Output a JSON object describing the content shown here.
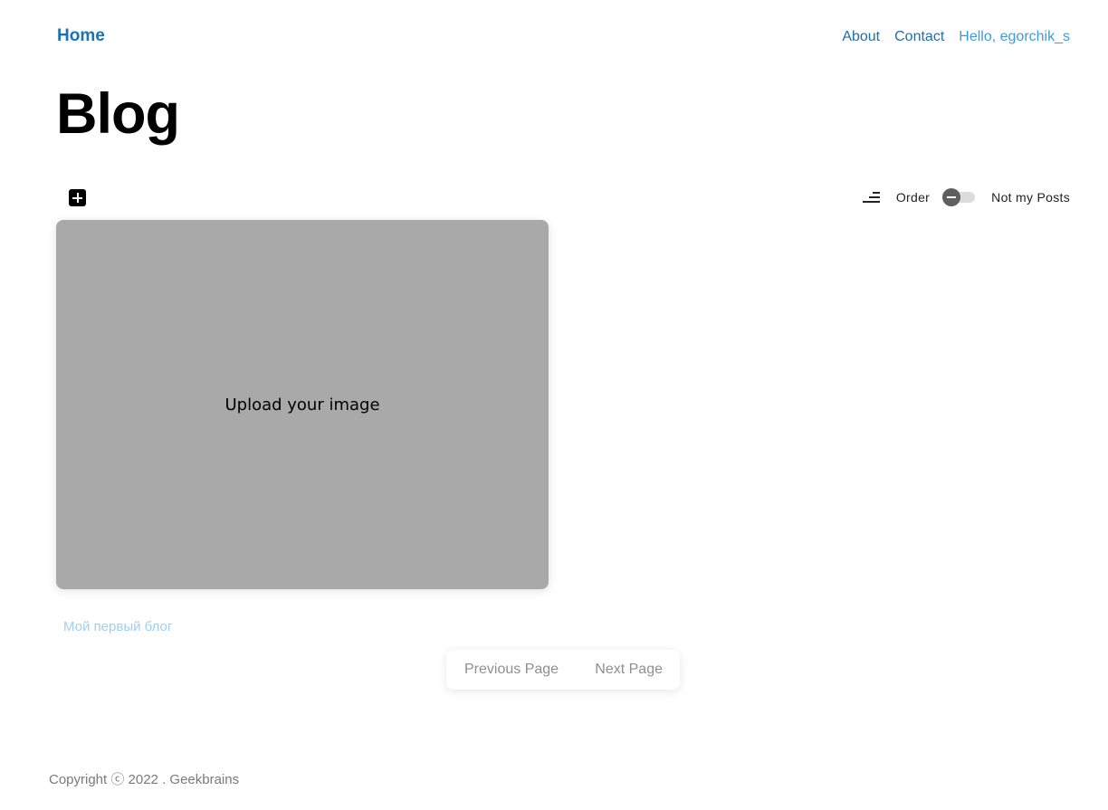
{
  "header": {
    "home_label": "Home",
    "links": [
      {
        "label": "About"
      },
      {
        "label": "Contact"
      }
    ],
    "user_greeting": "Hello, egorchik_s"
  },
  "page": {
    "title": "Blog"
  },
  "toolbar": {
    "add_icon": "plus-square-icon",
    "sort_icon": "sort-icon",
    "order_label": "Order",
    "toggle_state": "off",
    "filter_label": "Not my Posts"
  },
  "posts": [
    {
      "image_placeholder": "Upload your image",
      "title": "Мой первый блог"
    }
  ],
  "pagination": {
    "previous_label": "Previous Page",
    "next_label": "Next Page"
  },
  "footer": {
    "copyright": "Copyright ⓒ 2022 . Geekbrains"
  },
  "colors": {
    "primary_link": "#1a73b8",
    "user_link": "#3b9de0",
    "card_placeholder": "#a9a9a9",
    "post_title": "#9fd0ef"
  }
}
